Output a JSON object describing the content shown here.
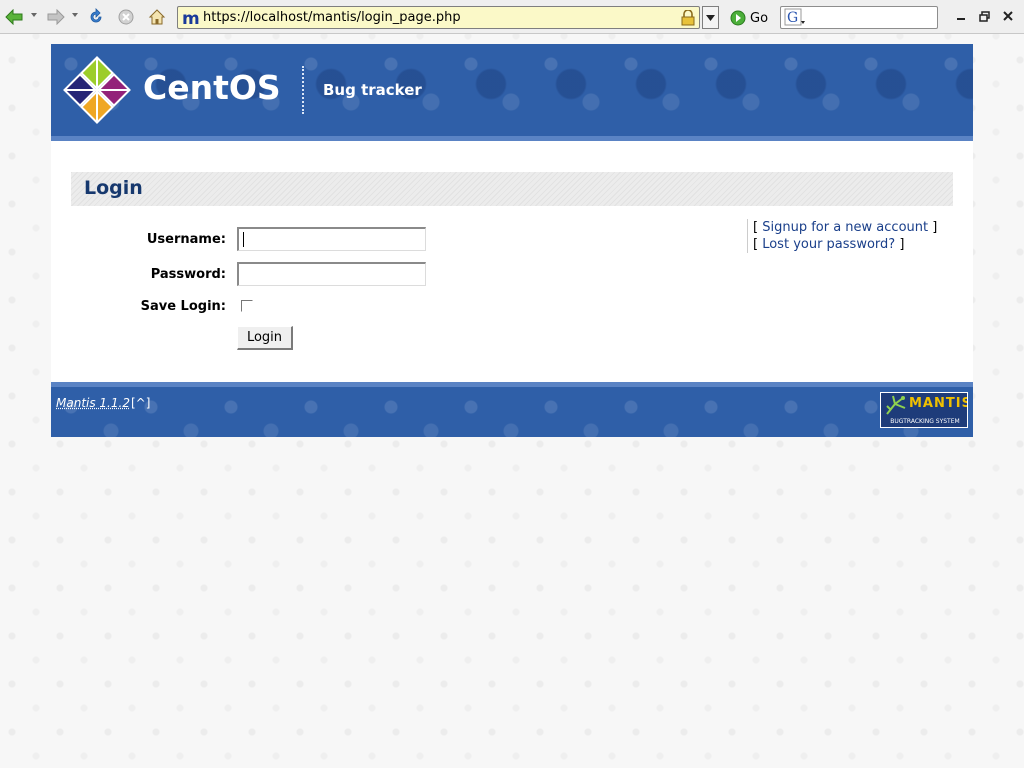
{
  "browser": {
    "url": "https://localhost/mantis/login_page.php",
    "go_label": "Go",
    "search_value": "",
    "icons": {
      "back": "back-arrow-icon",
      "forward": "forward-arrow-icon",
      "reload": "reload-icon",
      "stop": "stop-icon",
      "home": "home-icon",
      "lock": "lock-icon",
      "search_engine": "google-icon"
    }
  },
  "header": {
    "logo_text": "CentOS",
    "subtitle": "Bug tracker"
  },
  "login": {
    "title": "Login",
    "username_label": "Username:",
    "password_label": "Password:",
    "save_label": "Save Login:",
    "username_value": "",
    "password_value": "",
    "save_checked": false,
    "button_label": "Login"
  },
  "links": {
    "signup": "Signup for a new account",
    "lost_password": "Lost your password?",
    "open_bracket": "[",
    "close_bracket": "]"
  },
  "footer": {
    "version": "Mantis 1.1.2",
    "top_link": "[^]",
    "badge_word": "MANTIS",
    "badge_sub": "BUGTRACKING SYSTEM"
  },
  "colors": {
    "header_blue": "#2f5fa8",
    "title_text": "#16386e",
    "link": "#1a3f8a",
    "url_bar_bg": "#fbf9c8"
  }
}
